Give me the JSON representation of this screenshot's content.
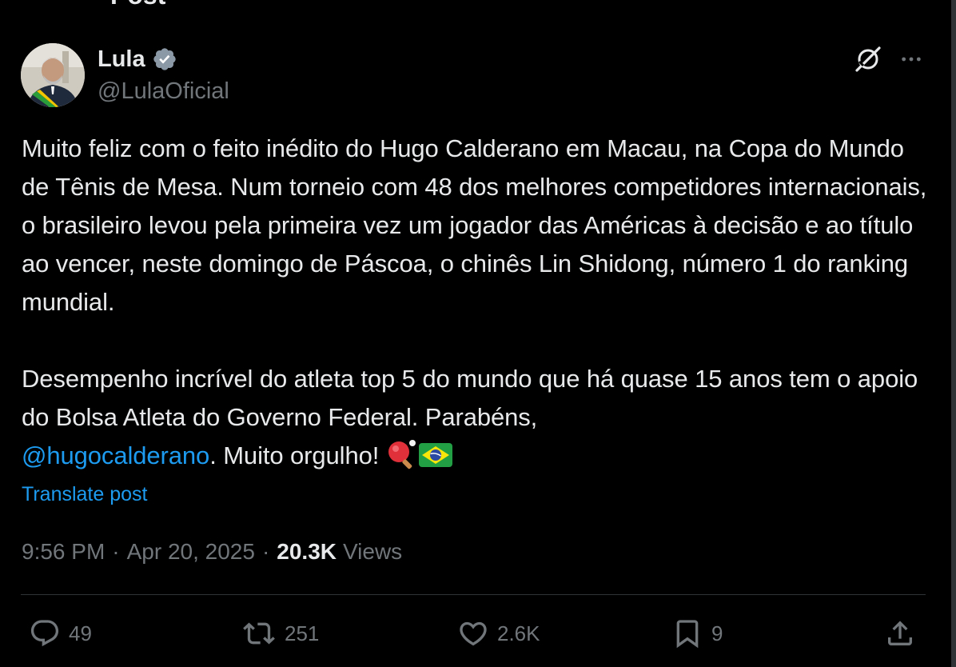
{
  "header": {
    "title": "Post",
    "back_icon": "arrow-left-icon"
  },
  "author": {
    "name": "Lula",
    "handle": "@LulaOficial",
    "verified_icon": "verified-badge-icon",
    "verified_color": "#8b98a5"
  },
  "actions_top": {
    "grok_icon": "grok-icon",
    "more_icon": "more-horizontal-icon"
  },
  "post": {
    "paragraph1": "Muito feliz com o feito inédito do Hugo Calderano em Macau, na Copa do Mundo de Tênis de Mesa. Num torneio com 48 dos melhores competidores internacionais, o brasileiro levou pela primeira vez um jogador das Américas à decisão e ao título ao vencer, neste domingo de Páscoa, o chinês Lin Shidong, número 1 do ranking mundial.",
    "paragraph2_text": "Desempenho incrível do atleta top 5 do mundo que há quase 15 anos tem o apoio do Bolsa Atleta do Governo Federal. Parabéns,",
    "mention": "@hugocalderano",
    "paragraph2_tail": ". Muito orgulho!",
    "emojis": [
      "ping-pong-paddle-emoji",
      "brazil-flag-emoji"
    ]
  },
  "translate_label": "Translate post",
  "meta": {
    "time": "9:56 PM",
    "date": "Apr 20, 2025",
    "separator": "·",
    "views_count": "20.3K",
    "views_label": "Views"
  },
  "action_bar": {
    "replies": "49",
    "reposts": "251",
    "likes": "2.6K",
    "bookmarks": "9",
    "icons": [
      "reply-icon",
      "repost-icon",
      "like-icon",
      "bookmark-icon",
      "share-icon"
    ]
  },
  "colors": {
    "background": "#000000",
    "text": "#e7e9ea",
    "muted": "#71767b",
    "accent": "#1d9bf0",
    "divider": "#2f3336"
  }
}
